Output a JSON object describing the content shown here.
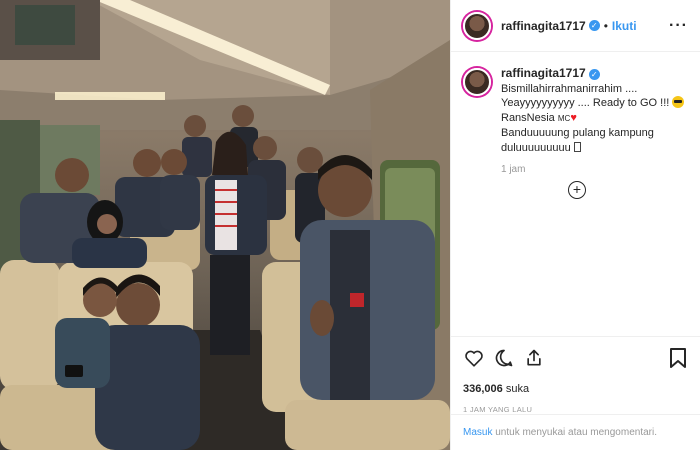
{
  "post": {
    "username": "raffinagita1717",
    "verified_icon": "verified-badge-icon",
    "follow_label": "Ikuti",
    "separator": "•",
    "more_label": "···",
    "caption": {
      "username": "raffinagita1717",
      "line1": "Bismillahirrahmanirrahim ....",
      "line2": "Yeayyyyyyyyyy .... Ready to GO !!!",
      "line3_text": "RansNesia",
      "line3_small": "MC",
      "line4": "Banduuuuung pulang kampung",
      "line5": "duluuuuuuuuu",
      "time": "1 jam"
    },
    "likes_count": "336,006",
    "likes_label": "suka",
    "posted_ago": "1 JAM YANG LALU",
    "footer": {
      "login_label": "Masuk",
      "rest": "untuk menyukai atau mengomentari."
    }
  },
  "icons": {
    "like": "heart-outline-icon",
    "comment": "comment-bubble-icon",
    "share": "share-icon",
    "save": "bookmark-icon",
    "load_more": "plus-circle-icon",
    "emoji": "sunglasses-emoji-icon",
    "heart_emoji": "red-heart-icon"
  },
  "colors": {
    "accent": "#3897f0",
    "text": "#262626",
    "muted": "#999999",
    "heart": "#ed1c24"
  }
}
